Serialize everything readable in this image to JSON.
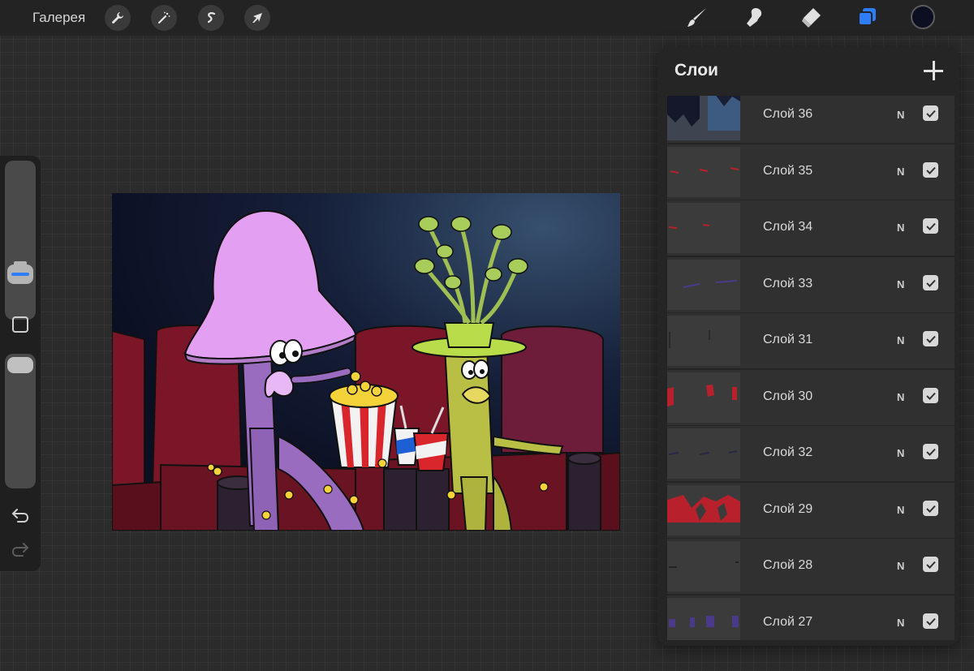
{
  "topbar": {
    "gallery_label": "Галерея",
    "left_tools": [
      "wrench-icon",
      "magic-wand-icon",
      "selection-s-icon",
      "arrow-cursor-icon"
    ],
    "right_tools": [
      "brush-icon",
      "smudge-icon",
      "eraser-icon",
      "layers-icon"
    ],
    "active_color": "#0c0f22",
    "accent": "#2e7cf6"
  },
  "sidebar": {
    "brush_size_level": 0.7,
    "opacity_level": 1.0
  },
  "layers_panel": {
    "title": "Слои",
    "layers": [
      {
        "name": "Слой 36",
        "blend": "N",
        "visible": true
      },
      {
        "name": "Слой 35",
        "blend": "N",
        "visible": true
      },
      {
        "name": "Слой 34",
        "blend": "N",
        "visible": true
      },
      {
        "name": "Слой 33",
        "blend": "N",
        "visible": true
      },
      {
        "name": "Слой 31",
        "blend": "N",
        "visible": true
      },
      {
        "name": "Слой 30",
        "blend": "N",
        "visible": true
      },
      {
        "name": "Слой 32",
        "blend": "N",
        "visible": true
      },
      {
        "name": "Слой 29",
        "blend": "N",
        "visible": true
      },
      {
        "name": "Слой 28",
        "blend": "N",
        "visible": true
      },
      {
        "name": "Слой 27",
        "blend": "N",
        "visible": true
      }
    ]
  }
}
